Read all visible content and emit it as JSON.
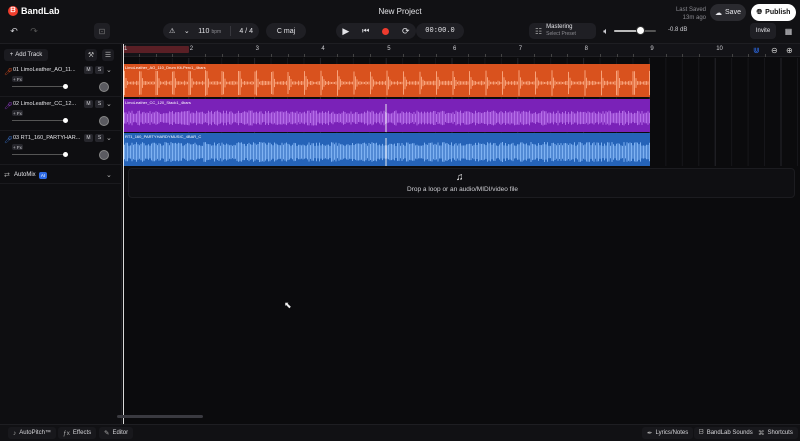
{
  "app": {
    "logo_text": "BandLab",
    "project_title": "New Project"
  },
  "header": {
    "last_saved_label": "Last Saved",
    "last_saved_value": "13m ago",
    "save_label": "Save",
    "publish_label": "Publish",
    "invite_label": "Invite"
  },
  "toolbar": {
    "tempo": "110",
    "tempo_unit": "bpm",
    "time_sig_top": "4",
    "time_sig_sep": "/",
    "time_sig_bottom": "4",
    "key": "C maj",
    "time_display": "00:00.0",
    "mastering_title": "Mastering",
    "mastering_sub": "Select Preset",
    "volume_db": "-0.8 dB",
    "volume_level": 0.62
  },
  "tracks_panel": {
    "add_track_label": "Add Track",
    "tracks": [
      {
        "name": "01 LimoLeather_AO_11...",
        "mute": "M",
        "solo": "S",
        "fx": "+ Fx",
        "color": "#e8501c",
        "volume": 0.95
      },
      {
        "name": "02 LimoLeather_CC_12...",
        "mute": "M",
        "solo": "S",
        "fx": "+ Fx",
        "color": "#9b3fd6",
        "volume": 0.95
      },
      {
        "name": "03 RT1_160_PARTYHAR...",
        "mute": "M",
        "solo": "S",
        "fx": "+ Fx",
        "color": "#3b7be0",
        "volume": 0.95
      }
    ],
    "automix_label": "AutoMix",
    "automix_badge": "AI"
  },
  "timeline": {
    "bars": [
      "1",
      "2",
      "3",
      "4",
      "5",
      "6",
      "7",
      "8",
      "9",
      "10"
    ],
    "clips": [
      {
        "label": "LimoLeather_AO_110_Drum Kit-Perc1_4bars"
      },
      {
        "label": "LimoLeather_CC_120_Stack1_4bars"
      },
      {
        "label": "RT1_160_PARTYHARDYMUSIC_4BAR_C"
      }
    ],
    "drop_text": "Drop a loop or an audio/MIDI/video file"
  },
  "bottombar": {
    "autopitch_label": "AutoPitch™",
    "effects_label": "Effects",
    "editor_label": "Editor",
    "lyrics_label": "Lyrics/Notes",
    "sounds_label": "BandLab Sounds",
    "shortcuts_label": "Shortcuts"
  },
  "colors": {
    "accent_record": "#ee3b2e",
    "automix_badge": "#2e6be6",
    "clip_orange": "#d9521e",
    "clip_purple": "#7a22b8",
    "clip_blue": "#2563b8"
  }
}
